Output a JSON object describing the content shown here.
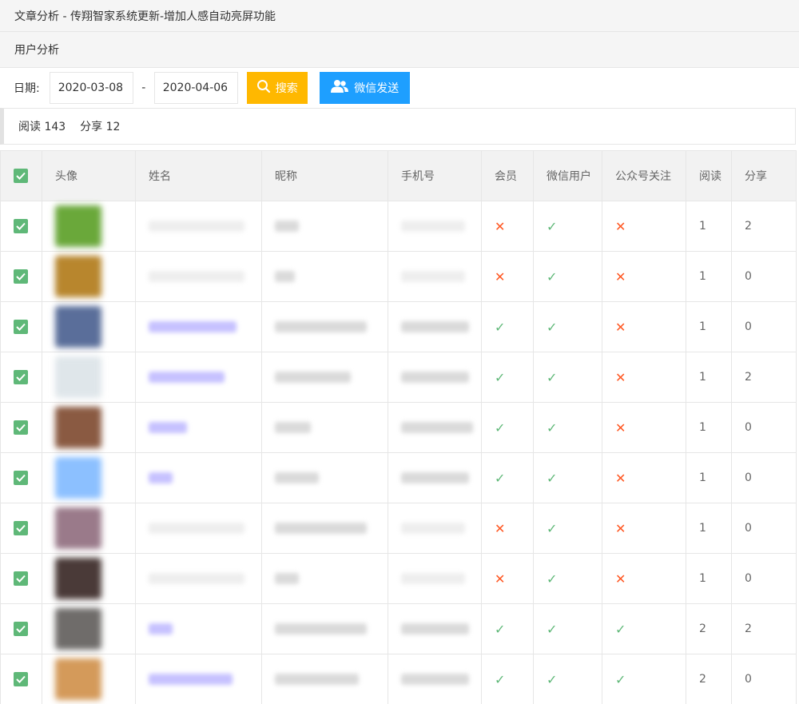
{
  "header": {
    "title": "文章分析 - 传翔智家系统更新-增加人感自动亮屏功能",
    "subtitle": "用户分析"
  },
  "filter": {
    "date_label": "日期:",
    "start_date": "2020-03-08",
    "separator": "-",
    "end_date": "2020-04-06",
    "search_label": "搜索",
    "wechat_send_label": "微信发送"
  },
  "stats": {
    "reads": "阅读 143",
    "shares": "分享 12"
  },
  "table": {
    "columns": [
      "头像",
      "姓名",
      "昵称",
      "手机号",
      "会员",
      "微信用户",
      "公众号关注",
      "阅读",
      "分享"
    ],
    "rows": [
      {
        "avatar_color": "#6aa83a",
        "name": "",
        "nickname": "",
        "phone": "",
        "member": false,
        "wechat_user": true,
        "follows": false,
        "reads": "1",
        "shares": "2"
      },
      {
        "avatar_color": "#b8862d",
        "name": "",
        "nickname": "",
        "phone": "",
        "member": false,
        "wechat_user": true,
        "follows": false,
        "reads": "1",
        "shares": "0"
      },
      {
        "avatar_color": "#5a6e9a",
        "name": "",
        "nickname": "",
        "phone": "",
        "member": true,
        "wechat_user": true,
        "follows": false,
        "reads": "1",
        "shares": "0"
      },
      {
        "avatar_color": "#dfe6ea",
        "name": "",
        "nickname": "",
        "phone": "",
        "member": true,
        "wechat_user": true,
        "follows": false,
        "reads": "1",
        "shares": "2"
      },
      {
        "avatar_color": "#8a5a42",
        "name": "",
        "nickname": "",
        "phone": "",
        "member": true,
        "wechat_user": true,
        "follows": false,
        "reads": "1",
        "shares": "0"
      },
      {
        "avatar_color": "#8cc0ff",
        "name": "",
        "nickname": "",
        "phone": "",
        "member": true,
        "wechat_user": true,
        "follows": false,
        "reads": "1",
        "shares": "0"
      },
      {
        "avatar_color": "#9a7a8a",
        "name": "",
        "nickname": "",
        "phone": "",
        "member": false,
        "wechat_user": true,
        "follows": false,
        "reads": "1",
        "shares": "0"
      },
      {
        "avatar_color": "#4a3a38",
        "name": "",
        "nickname": "",
        "phone": "",
        "member": false,
        "wechat_user": true,
        "follows": false,
        "reads": "1",
        "shares": "0"
      },
      {
        "avatar_color": "#6f6c6a",
        "name": "",
        "nickname": "",
        "phone": "",
        "member": true,
        "wechat_user": true,
        "follows": true,
        "reads": "2",
        "shares": "2"
      },
      {
        "avatar_color": "#d49a5a",
        "name": "",
        "nickname": "",
        "phone": "",
        "member": true,
        "wechat_user": true,
        "follows": true,
        "reads": "2",
        "shares": "0"
      }
    ]
  },
  "colors": {
    "search_button": "#ffb800",
    "wechat_button": "#1e9fff",
    "checkbox": "#5fb878",
    "yes_mark": "#5fb878",
    "no_mark": "#ff5722"
  }
}
